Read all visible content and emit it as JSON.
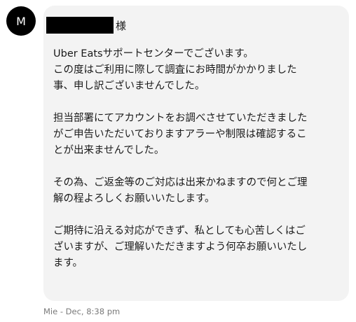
{
  "sender": {
    "avatar_initial": "M"
  },
  "message": {
    "honorific": "様",
    "paragraphs": [
      "Uber Eatsサポートセンターでございます。\nこの度はご利用に際して調査にお時間がかかりました\n事、申し訳ございませんでした。",
      "担当部署にてアカウントをお調べさせていただきました\nがご申告いただいておりますアラーや制限は確認するこ\nとが出来ませんでした。",
      "その為、ご返金等のご対応は出来かねますので何とご理\n解の程よろしくお願いいたします。",
      "ご期待に沿える対応ができず、私としても心苦しくはご\nざいますが、ご理解いただきますよう何卒お願いいたし\nます。"
    ]
  },
  "meta": {
    "timestamp": "Mie - Dec, 8:38 pm"
  }
}
